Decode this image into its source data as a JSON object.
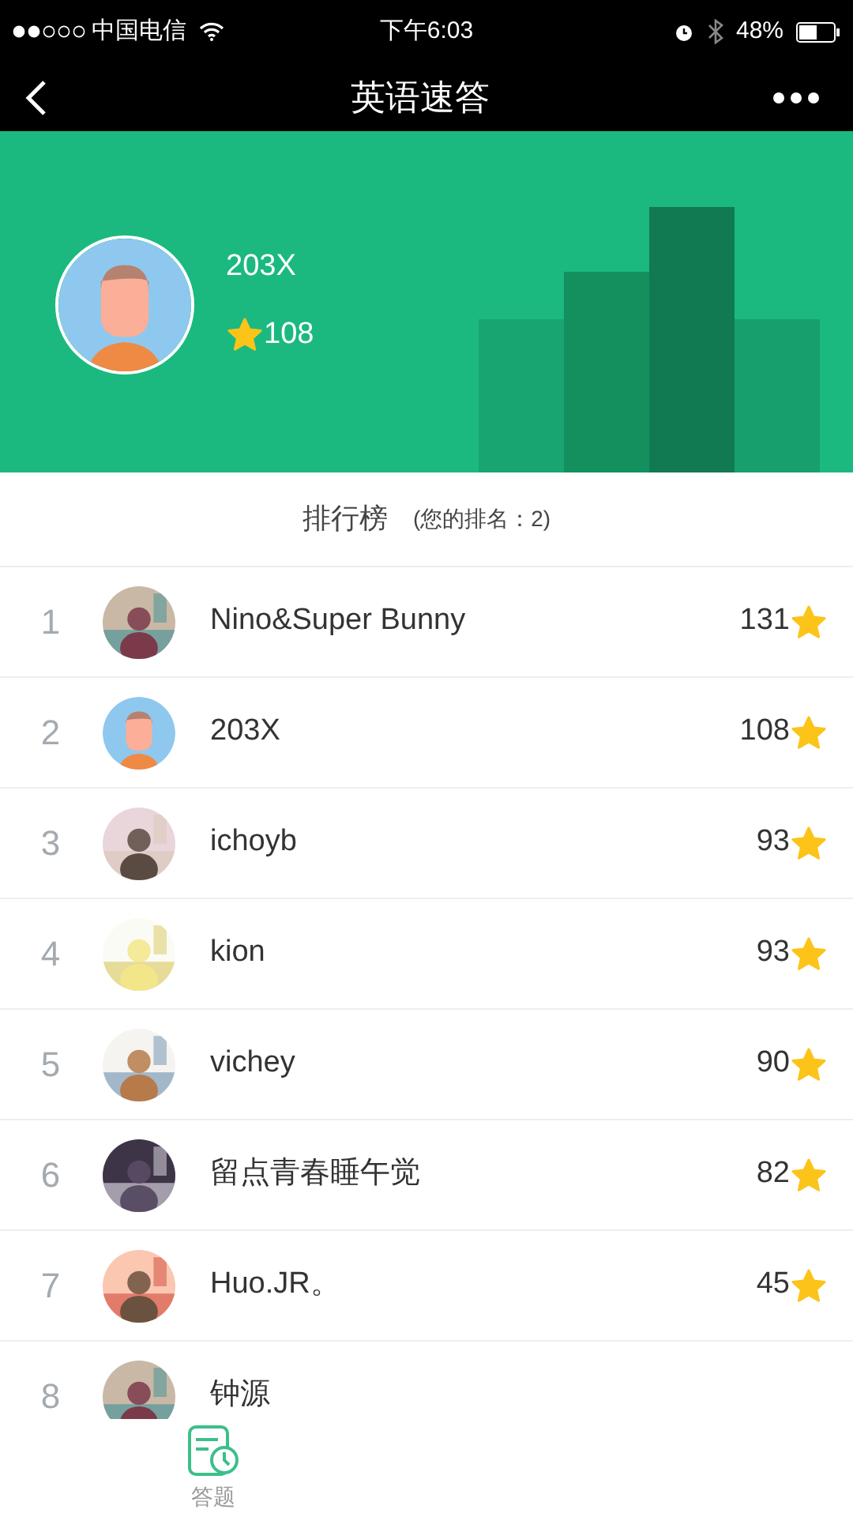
{
  "status_bar": {
    "carrier": "中国电信",
    "time": "下午6:03",
    "battery": "48%"
  },
  "nav": {
    "title": "英语速答"
  },
  "profile": {
    "name": "203X",
    "score": "108"
  },
  "leaderboard": {
    "title": "排行榜",
    "my_rank": "(您的排名：2)"
  },
  "rows": [
    {
      "rank": "1",
      "name": "Nino&Super Bunny",
      "score": "131"
    },
    {
      "rank": "2",
      "name": "203X",
      "score": "108",
      "avatar": {
        "kind": "cartoon"
      }
    },
    {
      "rank": "3",
      "name": "ichoyb",
      "score": "93"
    },
    {
      "rank": "4",
      "name": "kion",
      "score": "93"
    },
    {
      "rank": "5",
      "name": "vichey",
      "score": "90"
    },
    {
      "rank": "6",
      "name": "留点青春睡午觉",
      "score": "82"
    },
    {
      "rank": "7",
      "name": "Huo.JR。",
      "score": "45"
    },
    {
      "rank": "8",
      "name": "钟源"
    }
  ],
  "tab_bar": [
    {
      "label": "答题"
    }
  ]
}
